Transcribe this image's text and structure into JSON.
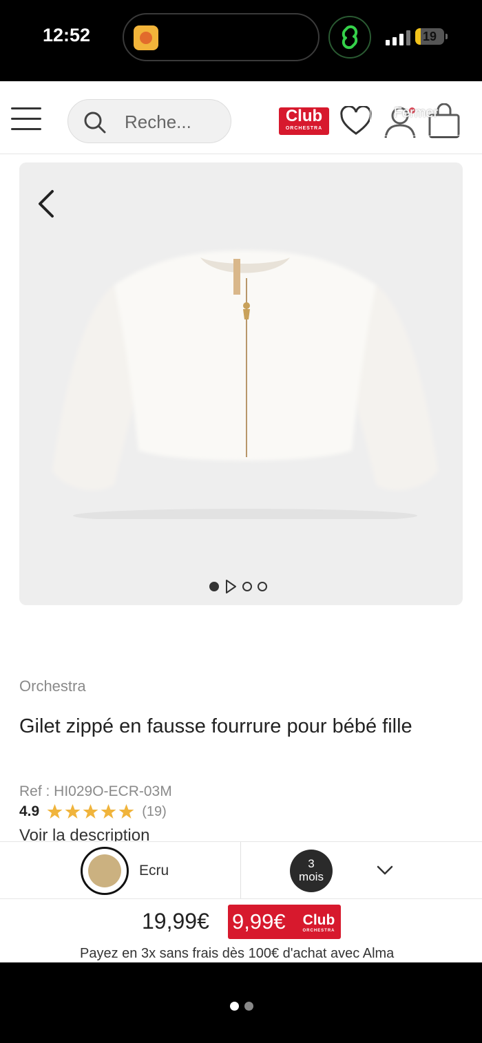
{
  "status_bar": {
    "time": "12:52",
    "battery_level": "19",
    "battery_fraction": 0.19,
    "battery_color": "#f1c21b",
    "signal_bars_filled": 3,
    "island_app_icon": "app-icon",
    "ring_icon": "link-icon"
  },
  "header": {
    "menu_icon": "hamburger-menu-icon",
    "search_placeholder": "Reche...",
    "club_logo": {
      "big": "Club",
      "small": "ORCHESTRA"
    },
    "wishlist_icon": "heart-icon",
    "account_icon": "user-icon",
    "cart_icon": "shopping-bag-icon",
    "overlay_label": "Fermer",
    "brand_color": "#d7192d"
  },
  "gallery": {
    "back_icon": "chevron-left-icon",
    "slide_count": 4,
    "active_slide": 1
  },
  "product": {
    "brand": "Orchestra",
    "title": "Gilet zippé en fausse fourrure pour bébé fille",
    "ref": "Ref : HI029O-ECR-03M",
    "rating": "4.9",
    "stars": 5,
    "review_count": "(19)",
    "description_link": "Voir la description"
  },
  "selector": {
    "color_name": "Ecru",
    "color_hex": "#cbb180",
    "size_number": "3",
    "size_unit": "mois",
    "dropdown_icon": "chevron-down-icon"
  },
  "price": {
    "regular": "19,99€",
    "club_price": "9,99€",
    "club_logo": {
      "big": "Club",
      "small": "ORCHESTRA"
    },
    "promo": "Payez en 3x sans frais dès 100€ d'achat avec Alma"
  },
  "home_indicator": {
    "pages": 2,
    "active": 1
  }
}
